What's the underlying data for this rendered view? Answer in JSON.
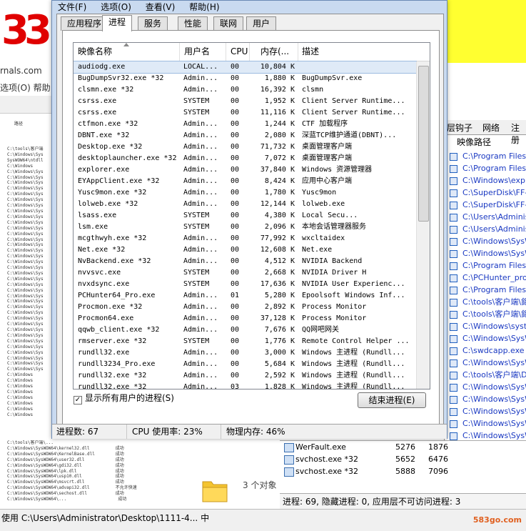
{
  "background": {
    "banner_text": [
      "3",
      "3"
    ],
    "strip_address": "rnals.com",
    "strip_menu": "选项(O)  帮助",
    "log_lines": [
      "C:\\tools\\客户端",
      "C:\\Windows\\Sys",
      "SysWOW64\\ntdll",
      "C:\\Windows",
      "C:\\Windows\\Sys",
      "C:\\Windows\\Sys",
      "C:\\Windows\\Sys",
      "C:\\Windows\\Sys",
      "C:\\Windows\\Sys",
      "C:\\Windows\\Sys",
      "C:\\Windows\\Sys",
      "C:\\Windows\\Sys",
      "C:\\Windows\\Sys",
      "C:\\Windows\\Sys",
      "C:\\Windows\\Sys",
      "C:\\Windows\\Sys",
      "C:\\Windows\\Sys",
      "C:\\Windows\\Sys",
      "C:\\Windows\\Sys",
      "C:\\Windows\\Sys",
      "C:\\Windows\\Sys",
      "C:\\Windows\\Sys",
      "C:\\Windows\\Sys",
      "C:\\Windows\\Sys",
      "C:\\Windows\\Sys",
      "C:\\Windows\\Sys",
      "C:\\Windows\\Sys",
      "C:\\Windows\\Sys",
      "C:\\Windows\\Sys",
      "C:\\Windows\\Sys",
      "C:\\Windows\\Sys",
      "C:\\Windows\\Sys",
      "C:\\Windows\\Sys",
      "C:\\Windows\\Sys",
      "C:\\Windows\\Sys",
      "C:\\Windows\\Sys",
      "C:\\Windows\\Sys",
      "C:\\Windows\\Sys",
      "C:\\Windows\\Sys",
      "C:\\Windows\\Sys",
      "C:\\Windows",
      "C:\\Windows",
      "C:\\Windows",
      "C:\\Windows",
      "C:\\Windows",
      "C:\\Windows",
      "C:\\Windows",
      "C:\\Windows"
    ],
    "log_tail": [
      "C:\\tools\\客户端\\...",
      "C:\\Windows\\SysWOW64\\kernel32.dll          成功",
      "C:\\Windows\\SysWOW64\\KernelBase.dll        成功",
      "C:\\Windows\\SysWOW64\\user32.dll            成功",
      "C:\\Windows\\SysWOW64\\gdi32.dll             成功",
      "C:\\Windows\\SysWOW64\\lpk.dll               成功",
      "C:\\Windows\\SysWOW64\\usp10.dll             成功",
      "C:\\Windows\\SysWOW64\\msvcrt.dll            成功",
      "C:\\Windows\\SysWOW64\\advapi32.dll          不允许快速",
      "C:\\Windows\\SysWOW64\\sechost.dll           成功",
      "C:\\Windows\\SysWOW64\\...                    成功"
    ],
    "log_header": "路径",
    "right_tabs": [
      "层钩子",
      "网络",
      "注册"
    ],
    "right_header": "映像路径",
    "right_paths": [
      "C:\\Program Files (x",
      "C:\\Program Files (x",
      "C:\\Windows\\explor",
      "C:\\SuperDisk\\FF-F",
      "C:\\SuperDisk\\FF-F",
      "C:\\Users\\Administ",
      "C:\\Users\\Administ",
      "C:\\Windows\\SysW",
      "C:\\Windows\\SysW",
      "C:\\Program Files (x",
      "C:\\PCHunter_pro\\P",
      "C:\\Program Files (x",
      "C:\\tools\\客户端\\鉅",
      "C:\\tools\\客户端\\鉅",
      "C:\\Windows\\syster",
      "C:\\Windows\\SysW",
      "C:\\swdcapp.exe",
      "C:\\Windows\\SysW",
      "C:\\tools\\客户端\\D",
      "C:\\Windows\\SysW",
      "C:\\Windows\\SysW",
      "C:\\Windows\\SysW",
      "C:\\Windows\\SysW",
      "C:\\Windows\\SysW",
      "C:\\Windows\\SysW",
      "C:\\Windows\\Syste",
      "C:\\Windows\\SysW",
      "C:\\Windows\\SysW"
    ],
    "proc_rows": [
      {
        "name": "WerFault.exe",
        "pid": "5276",
        "ppid": "1876"
      },
      {
        "name": "svchost.exe *32",
        "pid": "5652",
        "ppid": "6476"
      },
      {
        "name": "svchost.exe *32",
        "pid": "5888",
        "ppid": "7096"
      }
    ],
    "proc_status": "进程: 69, 隐藏进程: 0, 应用层不可访问进程: 3",
    "folder_text": "3 个对象",
    "bottom_bar": "使用 C:\\Users\\Administrator\\Desktop\\1111-4... 中",
    "watermark": "583go.com"
  },
  "task_manager": {
    "menu": [
      "文件(F)",
      "选项(O)",
      "查看(V)",
      "帮助(H)"
    ],
    "tabs": [
      "应用程序",
      "进程",
      "服务",
      "性能",
      "联网",
      "用户"
    ],
    "active_tab": "进程",
    "columns": [
      "映像名称",
      "用户名",
      "CPU",
      "内存(...",
      "描述"
    ],
    "rows": [
      {
        "name": "audiodg.exe",
        "user": "LOCAL...",
        "cpu": "00",
        "mem": "10,804 K",
        "desc": ""
      },
      {
        "name": "BugDumpSvr32.exe *32",
        "user": "Admin...",
        "cpu": "00",
        "mem": "1,880 K",
        "desc": "BugDumpSvr.exe"
      },
      {
        "name": "clsmn.exe *32",
        "user": "Admin...",
        "cpu": "00",
        "mem": "16,392 K",
        "desc": "clsmn"
      },
      {
        "name": "csrss.exe",
        "user": "SYSTEM",
        "cpu": "00",
        "mem": "1,952 K",
        "desc": "Client Server Runtime..."
      },
      {
        "name": "csrss.exe",
        "user": "SYSTEM",
        "cpu": "00",
        "mem": "11,116 K",
        "desc": "Client Server Runtime..."
      },
      {
        "name": "ctfmon.exe *32",
        "user": "Admin...",
        "cpu": "00",
        "mem": "1,244 K",
        "desc": "CTF 加载程序"
      },
      {
        "name": "DBNT.exe *32",
        "user": "Admin...",
        "cpu": "00",
        "mem": "2,080 K",
        "desc": "深蓝TCP维护通道(DBNT)..."
      },
      {
        "name": "Desktop.exe *32",
        "user": "Admin...",
        "cpu": "00",
        "mem": "71,732 K",
        "desc": "桌面管理客户端"
      },
      {
        "name": "desktoplauncher.exe *32",
        "user": "Admin...",
        "cpu": "00",
        "mem": "7,072 K",
        "desc": "桌面管理客户端"
      },
      {
        "name": "explorer.exe",
        "user": "Admin...",
        "cpu": "00",
        "mem": "37,840 K",
        "desc": "Windows 资源管理器"
      },
      {
        "name": "EYAppClient.exe *32",
        "user": "Admin...",
        "cpu": "00",
        "mem": "8,424 K",
        "desc": "应用中心客户端"
      },
      {
        "name": "Yusc9mon.exe *32",
        "user": "Admin...",
        "cpu": "00",
        "mem": "1,780 K",
        "desc": "Yusc9mon"
      },
      {
        "name": "lolweb.exe *32",
        "user": "Admin...",
        "cpu": "00",
        "mem": "12,144 K",
        "desc": "lolweb.exe"
      },
      {
        "name": "lsass.exe",
        "user": "SYSTEM",
        "cpu": "00",
        "mem": "4,380 K",
        "desc": "Local Secu..."
      },
      {
        "name": "lsm.exe",
        "user": "SYSTEM",
        "cpu": "00",
        "mem": "2,096 K",
        "desc": "本地会话管理器服务"
      },
      {
        "name": "mcgthwyh.exe *32",
        "user": "Admin...",
        "cpu": "00",
        "mem": "77,992 K",
        "desc": "wxcltaidex"
      },
      {
        "name": "Net.exe *32",
        "user": "Admin...",
        "cpu": "00",
        "mem": "12,608 K",
        "desc": "Net.exe"
      },
      {
        "name": "NvBackend.exe *32",
        "user": "Admin...",
        "cpu": "00",
        "mem": "4,512 K",
        "desc": "NVIDIA Backend"
      },
      {
        "name": "nvvsvc.exe",
        "user": "SYSTEM",
        "cpu": "00",
        "mem": "2,668 K",
        "desc": "NVIDIA Driver H"
      },
      {
        "name": "nvxdsync.exe",
        "user": "SYSTEM",
        "cpu": "00",
        "mem": "17,636 K",
        "desc": "NVIDIA User Experienc..."
      },
      {
        "name": "PCHunter64_Pro.exe",
        "user": "Admin...",
        "cpu": "01",
        "mem": "5,280 K",
        "desc": "Epoolsoft Windows Inf..."
      },
      {
        "name": "Procmon.exe *32",
        "user": "Admin...",
        "cpu": "00",
        "mem": "2,892 K",
        "desc": "Process Monitor"
      },
      {
        "name": "Procmon64.exe",
        "user": "Admin...",
        "cpu": "00",
        "mem": "37,128 K",
        "desc": "Process Monitor"
      },
      {
        "name": "qqwb_client.exe *32",
        "user": "Admin...",
        "cpu": "00",
        "mem": "7,676 K",
        "desc": "QQ网吧网关"
      },
      {
        "name": "rmserver.exe *32",
        "user": "SYSTEM",
        "cpu": "00",
        "mem": "1,776 K",
        "desc": "Remote Control Helper ..."
      },
      {
        "name": "rundll32.exe",
        "user": "Admin...",
        "cpu": "00",
        "mem": "3,000 K",
        "desc": "Windows 主进程 (Rundll..."
      },
      {
        "name": "rundll3234_Pro.exe",
        "user": "Admin...",
        "cpu": "00",
        "mem": "5,684 K",
        "desc": "Windows 主进程 (Rundll..."
      },
      {
        "name": "rundll32.exe *32",
        "user": "Admin...",
        "cpu": "00",
        "mem": "2,592 K",
        "desc": "Windows 主进程 (Rundll..."
      },
      {
        "name": "rundll32.exe *32",
        "user": "Admin...",
        "cpu": "03",
        "mem": "1,828 K",
        "desc": "Windows 主进程 (Rundll..."
      }
    ],
    "show_all_label": "显示所有用户的进程(S)",
    "show_all_checked": "✓",
    "end_process_label": "结束进程(E)",
    "status": {
      "processes": "进程数: 67",
      "cpu": "CPU 使用率: 23%",
      "memory": "物理内存: 46%"
    }
  }
}
